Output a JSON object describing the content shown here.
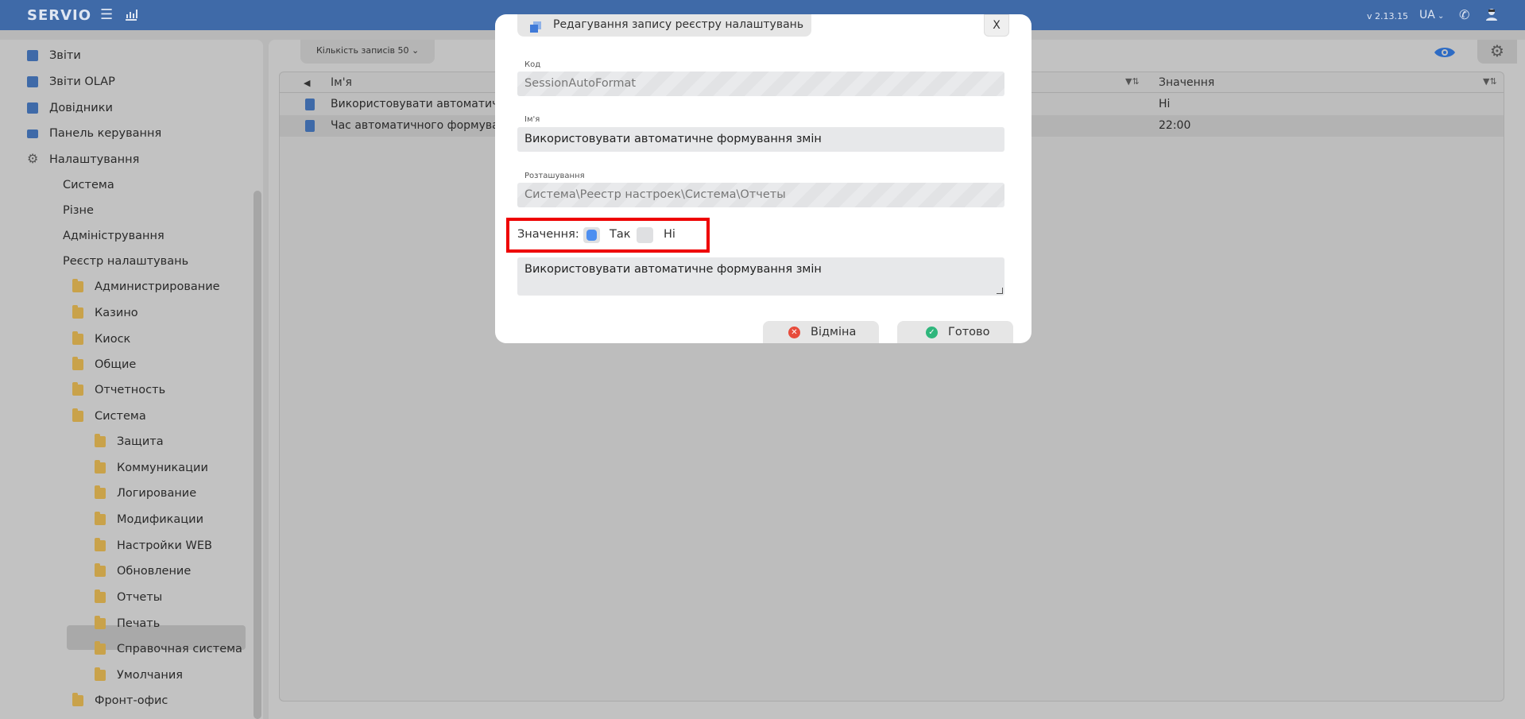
{
  "topbar": {
    "logo": "SERVIO",
    "version": "v 2.13.15",
    "language": "UA"
  },
  "sidebar": {
    "items": [
      {
        "label": "Звіти",
        "icon": "document-icon"
      },
      {
        "label": "Звіти OLAP",
        "icon": "document-icon"
      },
      {
        "label": "Довідники",
        "icon": "book-icon"
      },
      {
        "label": "Панель керування",
        "icon": "dashboard-icon"
      },
      {
        "label": "Налаштування",
        "icon": "gear-icon"
      },
      {
        "label": "Система"
      },
      {
        "label": "Різне"
      },
      {
        "label": "Адміністрування"
      },
      {
        "label": "Реєстр налаштувань"
      },
      {
        "label": "Администрирование",
        "icon": "folder-icon"
      },
      {
        "label": "Казино",
        "icon": "folder-icon"
      },
      {
        "label": "Киоск",
        "icon": "folder-icon"
      },
      {
        "label": "Общие",
        "icon": "folder-icon"
      },
      {
        "label": "Отчетность",
        "icon": "folder-icon"
      },
      {
        "label": "Система",
        "icon": "folder-icon"
      },
      {
        "label": "Защита",
        "icon": "folder-icon"
      },
      {
        "label": "Коммуникации",
        "icon": "folder-icon"
      },
      {
        "label": "Логирование",
        "icon": "folder-icon"
      },
      {
        "label": "Модификации",
        "icon": "folder-icon"
      },
      {
        "label": "Настройки WEB",
        "icon": "folder-icon"
      },
      {
        "label": "Обновление",
        "icon": "folder-icon"
      },
      {
        "label": "Отчеты",
        "icon": "folder-icon",
        "selected": true
      },
      {
        "label": "Печать",
        "icon": "folder-icon"
      },
      {
        "label": "Справочная система",
        "icon": "folder-icon"
      },
      {
        "label": "Умолчания",
        "icon": "folder-icon"
      },
      {
        "label": "Фронт-офис",
        "icon": "folder-icon"
      }
    ]
  },
  "main": {
    "records_label": "Кількість записів",
    "records_count": "50",
    "columns": [
      "Ім'я",
      "Значення"
    ],
    "rows": [
      {
        "name": "Використовувати автоматичн",
        "value": "Ні"
      },
      {
        "name": "Час автоматичного формуван",
        "value": "22:00"
      }
    ]
  },
  "modal": {
    "title": "Редагування запису реєстру налаштувань",
    "close_label": "X",
    "code_label": "Код",
    "code_value": "SessionAutoFormat",
    "name_label": "Ім'я",
    "name_value": "Використовувати автоматичне формування змін",
    "location_label": "Розташування",
    "location_value": "Система\\Реестр настроек\\Система\\Отчеты",
    "value_label": "Значення:",
    "option_yes": "Так",
    "option_no": "Ні",
    "selected_option": "Так",
    "description": "Використовувати автоматичне формування змін",
    "cancel_label": "Відміна",
    "ok_label": "Готово"
  },
  "colors": {
    "topbar": "#3f6aa8",
    "highlight": "#ee0000",
    "radio_on": "#4e8ff0",
    "cancel": "#e74c3c",
    "ok": "#2fb67c"
  }
}
